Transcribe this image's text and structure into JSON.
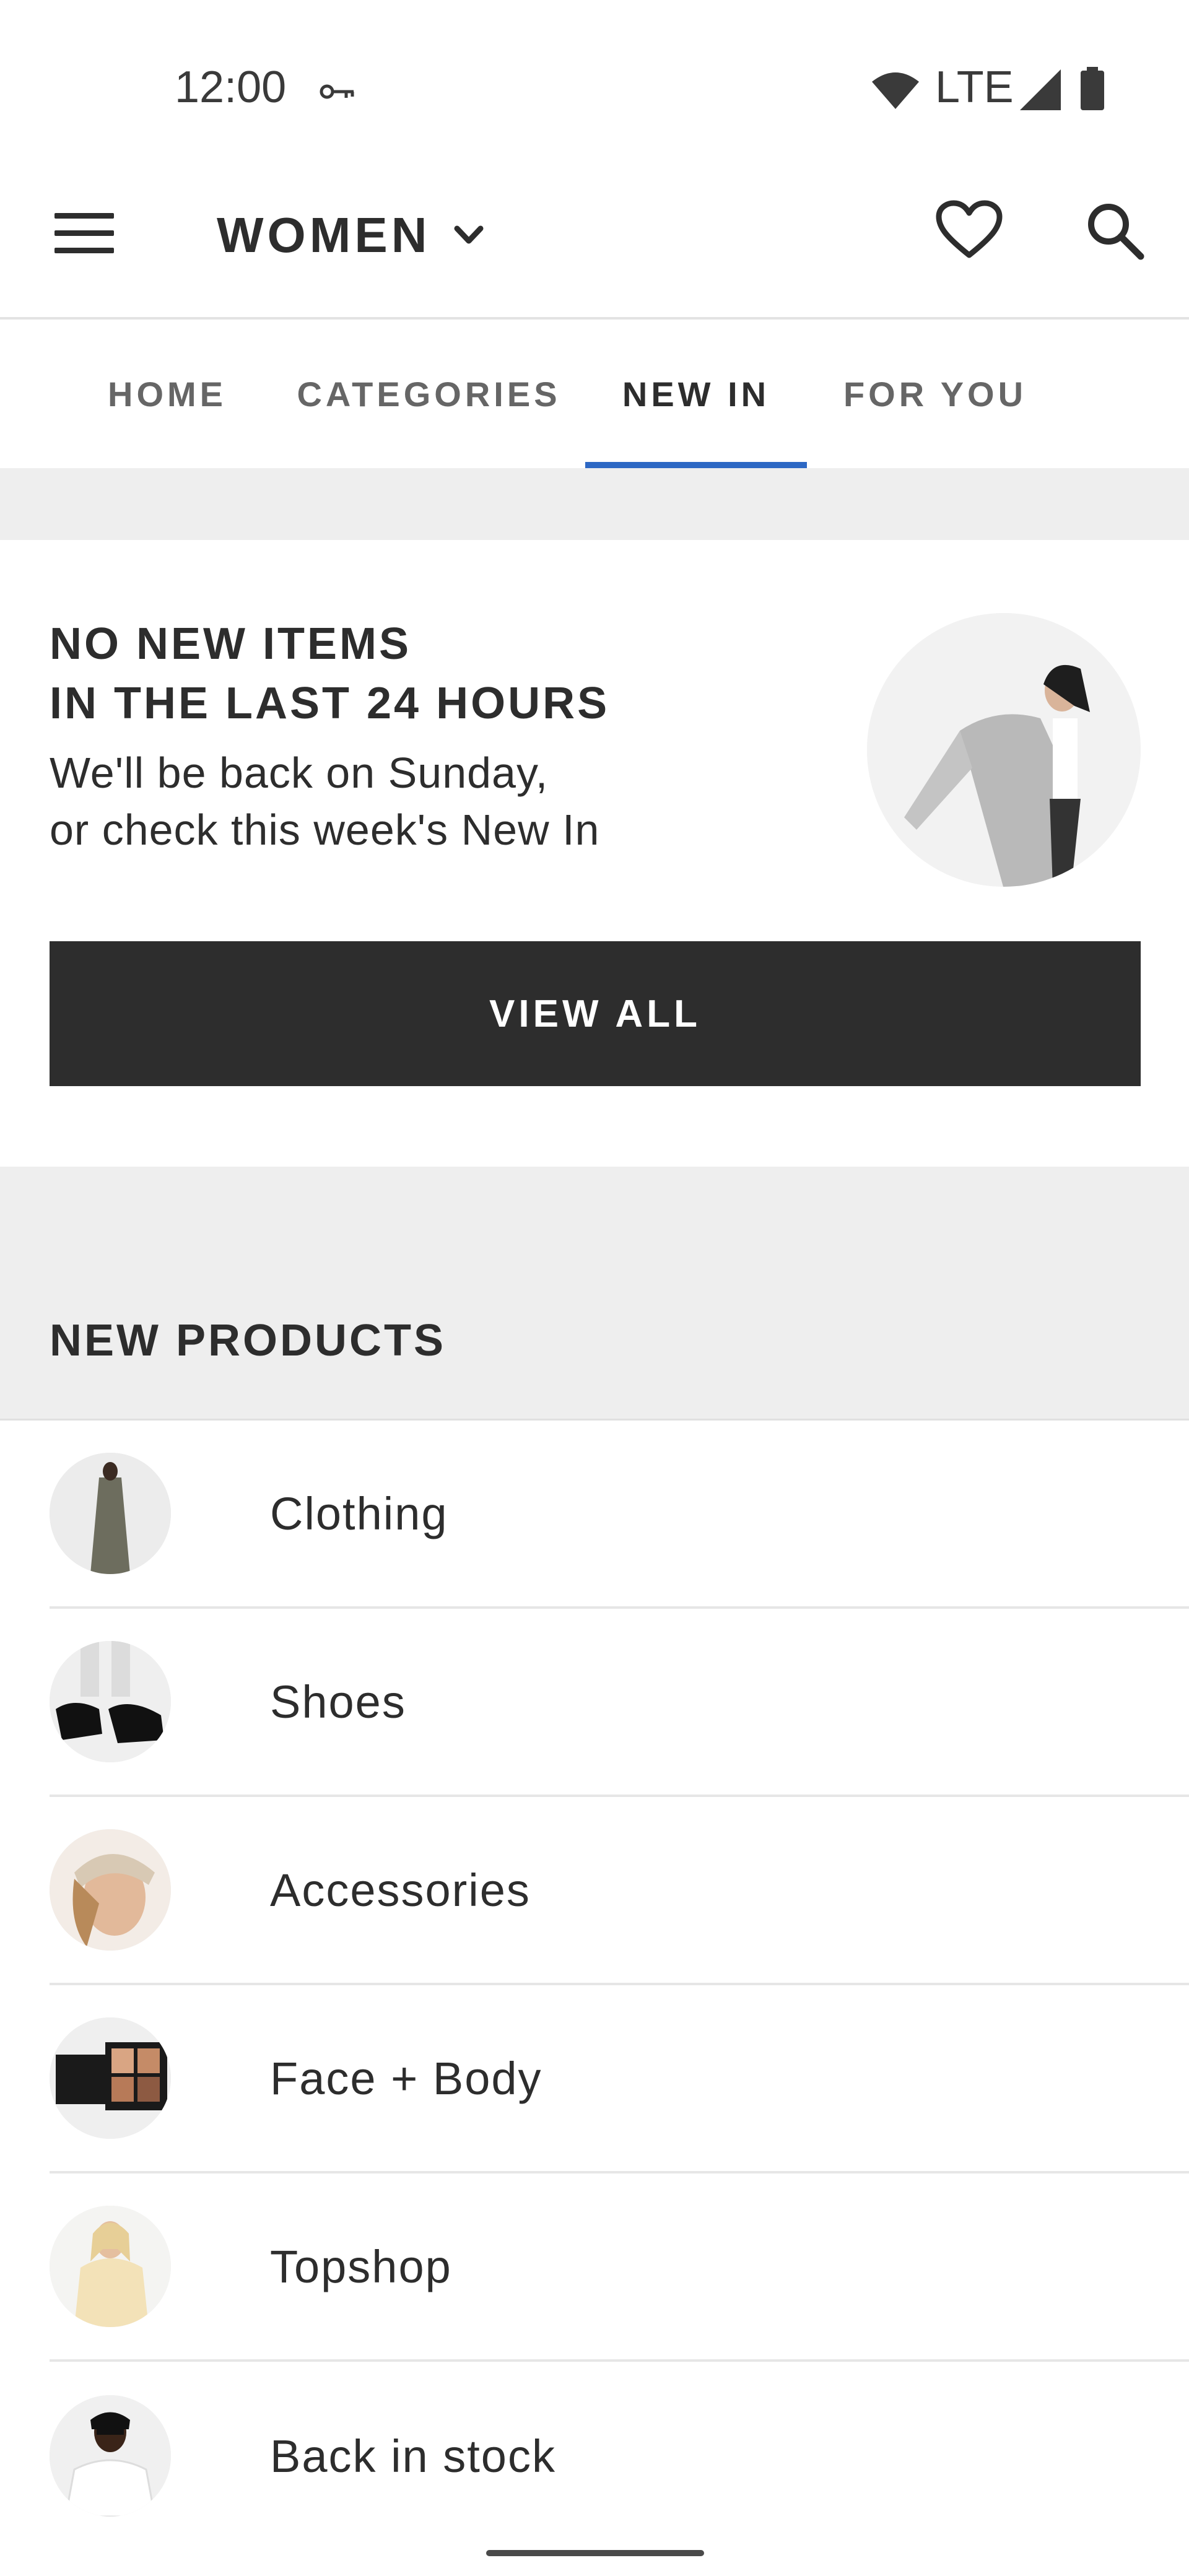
{
  "status_bar": {
    "time": "12:00",
    "network": "LTE",
    "icons": [
      "key-icon",
      "wifi-icon",
      "signal-icon",
      "battery-icon"
    ]
  },
  "header": {
    "department": "WOMEN",
    "icons": [
      "menu-icon",
      "chevron-down-icon",
      "heart-icon",
      "search-icon"
    ]
  },
  "tabs": [
    {
      "label": "HOME",
      "active": false
    },
    {
      "label": "CATEGORIES",
      "active": false
    },
    {
      "label": "NEW IN",
      "active": true
    },
    {
      "label": "FOR YOU",
      "active": false
    }
  ],
  "promo": {
    "heading_line1": "NO NEW ITEMS",
    "heading_line2": "IN THE LAST 24 HOURS",
    "sub_line1": "We'll be back on Sunday,",
    "sub_line2": "or check this week's New In",
    "button_label": "VIEW ALL"
  },
  "new_products": {
    "title": "NEW PRODUCTS",
    "items": [
      {
        "label": "Clothing"
      },
      {
        "label": "Shoes"
      },
      {
        "label": "Accessories"
      },
      {
        "label": "Face + Body"
      },
      {
        "label": "Topshop"
      },
      {
        "label": "Back in stock"
      }
    ]
  },
  "colors": {
    "accent": "#2d68c4",
    "text": "#2d2d2d",
    "button_bg": "#2d2d2d",
    "band_bg": "#eeeeee"
  }
}
